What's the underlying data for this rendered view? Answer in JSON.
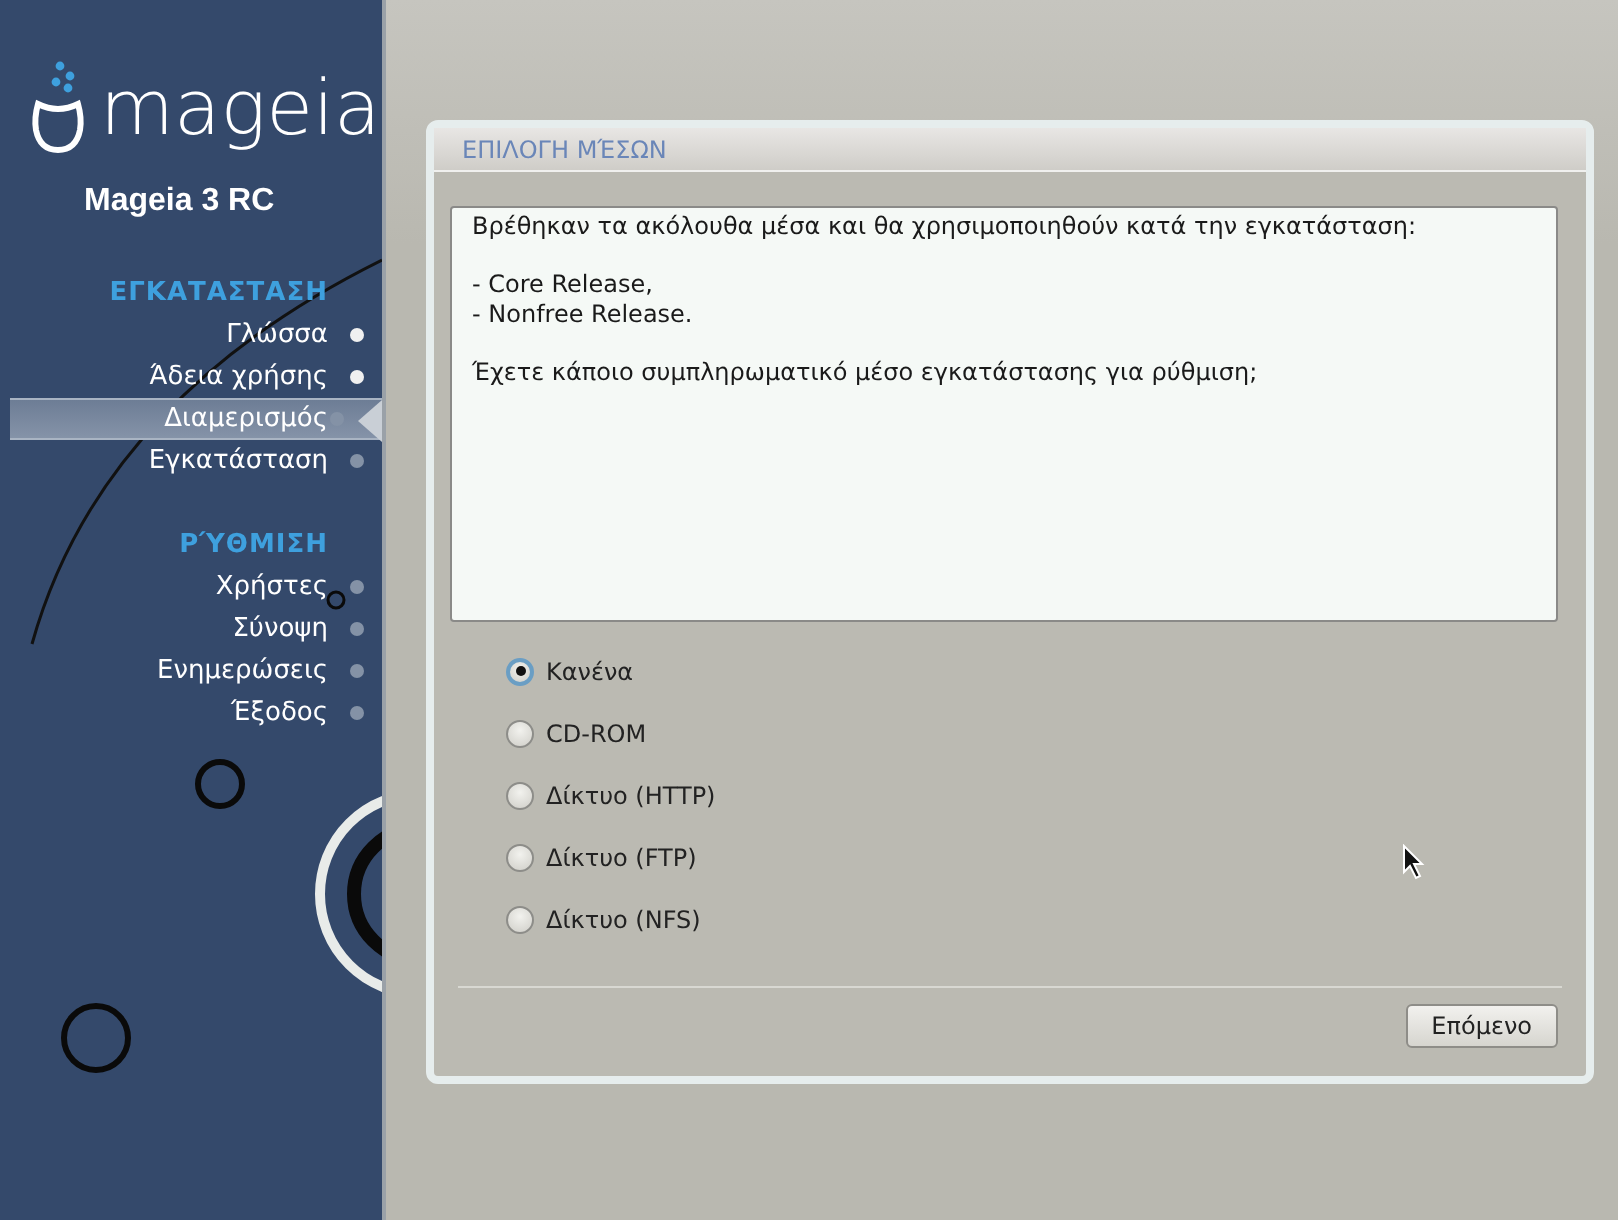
{
  "sidebar": {
    "logo": "mageia",
    "product": "Mageia 3 RC",
    "sections": [
      {
        "heading": "ΕΓΚΑΤΑΣΤΑΣΗ",
        "steps": [
          {
            "label": "Γλώσσα",
            "completed": true,
            "selected": false
          },
          {
            "label": "Άδεια χρήσης",
            "completed": true,
            "selected": false
          },
          {
            "label": "Διαμερισμός",
            "completed": false,
            "selected": true
          },
          {
            "label": "Εγκατάσταση",
            "completed": false,
            "selected": false
          }
        ]
      },
      {
        "heading": "ΡΎΘΜΙΣΗ",
        "steps": [
          {
            "label": "Χρήστες",
            "completed": false,
            "selected": false
          },
          {
            "label": "Σύνοψη",
            "completed": false,
            "selected": false
          },
          {
            "label": "Ενημερώσεις",
            "completed": false,
            "selected": false
          },
          {
            "label": "Έξοδος",
            "completed": false,
            "selected": false
          }
        ]
      }
    ]
  },
  "panel": {
    "title": "ΕΠΙΛΟΓΗ ΜΈΣΩΝ",
    "message": [
      "Βρέθηκαν τα ακόλουθα μέσα και θα χρησιμοποιηθούν κατά την εγκατάσταση:",
      "- Core Release,\n- Nonfree Release.",
      "Έχετε κάποιο συμπληρωματικό μέσο εγκατάστασης για ρύθμιση;"
    ],
    "options": [
      {
        "label": "Κανένα",
        "selected": true
      },
      {
        "label": "CD-ROM",
        "selected": false
      },
      {
        "label": "Δίκτυο (HTTP)",
        "selected": false
      },
      {
        "label": "Δίκτυο (FTP)",
        "selected": false
      },
      {
        "label": "Δίκτυο (NFS)",
        "selected": false
      }
    ],
    "buttons": [
      "Επόμενο"
    ]
  }
}
